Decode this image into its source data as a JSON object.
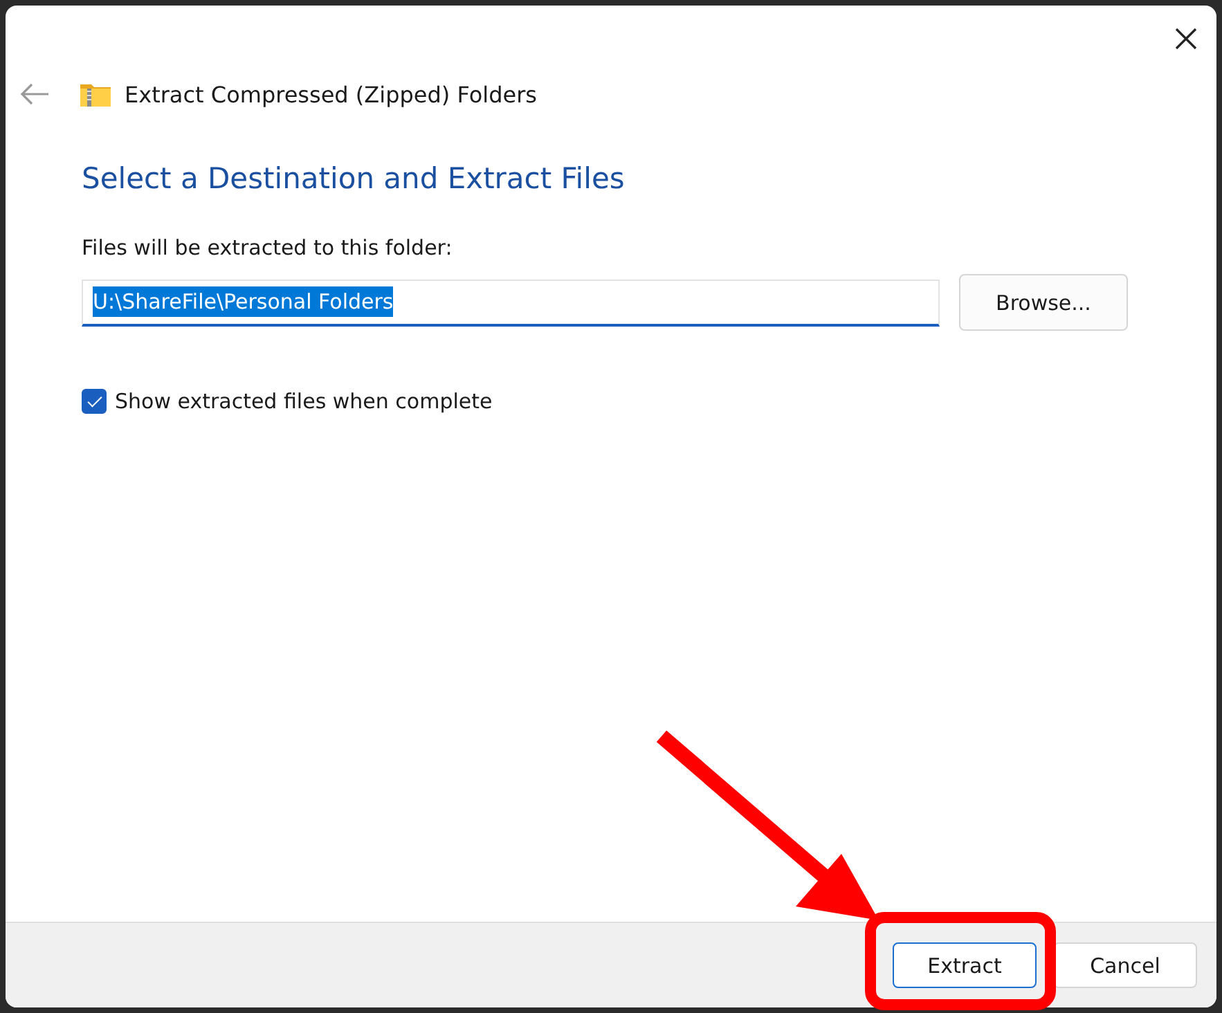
{
  "window": {
    "title": "Extract Compressed (Zipped) Folders"
  },
  "heading": "Select a Destination and Extract Files",
  "destination": {
    "label": "Files will be extracted to this folder:",
    "value": "U:\\ShareFile\\Personal Folders",
    "text_selected": true
  },
  "show_files": {
    "label": "Show extracted files when complete",
    "checked": true
  },
  "browse_button": "Browse...",
  "buttons": [
    {
      "label": "Extract",
      "default": true
    },
    {
      "label": "Cancel",
      "default": false
    }
  ],
  "annotation": {
    "kind": "arrow_to_box"
  }
}
